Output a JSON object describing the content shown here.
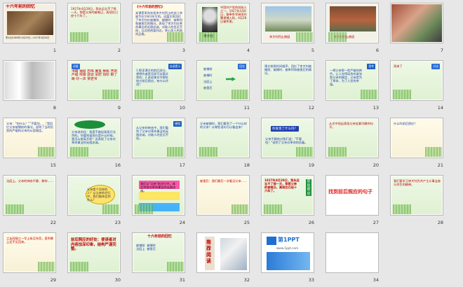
{
  "slides": [
    {
      "n": "1",
      "title": "十六年前的回忆",
      "caption": "李大钊1889年10月29日—1927年4月28日"
    },
    {
      "n": "2",
      "text": "1927年4月28日，我永远忘不了那一天，那是父亲的被难日，离现在已经十六年了。"
    },
    {
      "n": "3",
      "title": "《十六年前的回忆》",
      "text": "本课是革命先驱李大钊烈士的女儿李星华在1943年写的。这篇文章回忆了李大钊在被捕前、被捕时、被审时和被害后的情况，表现了李大钊对革命事业的无限忠诚，对敌人的坚贞不屈，以及他热爱同志，关心家人的高尚品格。"
    },
    {
      "n": "4",
      "caption": "李大钊",
      "text": "中国共产党的创始人之一。1927年4月6日，被奉系军阀张作霖逮捕入狱，4月28日被杀害。"
    },
    {
      "n": "5",
      "caption": "李大钊烈士陵园"
    },
    {
      "n": "6",
      "caption": "李大钊烈士故居"
    },
    {
      "n": "7"
    },
    {
      "n": "8",
      "badge": "生字",
      "chars": "僵 魂 宪 竭 屑 窃 寓 匪 赐 溜 僵 案"
    },
    {
      "n": "9",
      "badge": "词语",
      "words": "书籍 抽屉 恐怖 魔鬼 肿胀 苦刑 严峻 残暴 匪徒 安慰 窃听 瞅了瞅 吁一声 贺老爷"
    },
    {
      "n": "10",
      "text": "1.默读课文的前后部分，想想作者是怎样写这篇文章的；2.说说课文中哪些地方前后照应，有什么作用？",
      "badge": "自读提示"
    },
    {
      "n": "11",
      "items": [
        "被捕前",
        "被捕时",
        "法庭上",
        "被害后"
      ],
      "badge": "回忆"
    },
    {
      "n": "12",
      "text": "课文按照时间顺序，回忆了李大钊被捕前、被捕时、被审时和被害后的情况。"
    },
    {
      "n": "13",
      "text": "一想父亲那一脸严峻的神色，让人觉得局势的紧张和父亲的镇定，父亲是为了革命，为了人民的幸福。",
      "badge": "思考"
    },
    {
      "n": "14",
      "text": "雨来了",
      "badge": "讨论"
    },
    {
      "n": "15",
      "text": "父亲：\"怕什么？\"\"不要怕……\"是回忆父亲被捕前的情况，说明了当时形势的严峻和父亲的从容镇定。"
    },
    {
      "n": "16",
      "text": "父亲说的话：我是不能轻易离开北京的。你要知道现在是什么时候，我怎么能离开呢？这表现了父亲对革命事业的无限忠诚。"
    },
    {
      "n": "17",
      "text": "从父亲的神态中，我们看到了父亲对革命事业的无限忠诚，对敌人的坚贞不屈。",
      "badge": "感悟"
    },
    {
      "n": "18",
      "text": "父亲被捕时，我们看到了一个什么样的父亲？从哪些语句可以看出来？"
    },
    {
      "n": "19",
      "badge": "你发现了什么吗？",
      "text": "父亲平静地对我们说：\"不要怕！\"说明了父亲对革命的执着。"
    },
    {
      "n": "20",
      "text": "从文中找出表现父亲处事冷静的句子。"
    },
    {
      "n": "21",
      "text": "什么叫前后照应？"
    },
    {
      "n": "22",
      "text": "法庭上，父亲的神态平静、慈祥……"
    },
    {
      "n": "23",
      "text": "父亲是个怎样的人？从父亲的言行中，我们能体会到什么？",
      "badge": "父亲"
    },
    {
      "n": "24",
      "text": "我们从\"父亲\"的言行中，体会到他对革命事业的无限忠诚。"
    },
    {
      "n": "25",
      "text": "被害后：我们最后一次看见父亲……"
    },
    {
      "n": "26",
      "text": "1927年4月28日，我永远忘不了那一天，那是父亲的被难日，离现在已经十六年了。",
      "label": "前后照应"
    },
    {
      "n": "27",
      "title": "找到前后照应的句子"
    },
    {
      "n": "28",
      "text": "我们要学习李大钊为共产主义事业奋斗终生的精神。"
    },
    {
      "n": "29",
      "text": "工友阎振三一早上街买东西，直到晚上还不见回来。"
    },
    {
      "n": "30",
      "text": "前后照应的好处：使读者对内容加深印象，结构严谨完整。",
      "badge": "总结"
    },
    {
      "n": "31",
      "title": "十六年前的回忆",
      "text": "被捕前  被捕时  法庭上  被害后"
    },
    {
      "n": "32",
      "title": "推荐阅读"
    },
    {
      "n": "33",
      "title": "第1PPT",
      "text": "www.1ppt.com"
    },
    {
      "n": "34"
    }
  ]
}
